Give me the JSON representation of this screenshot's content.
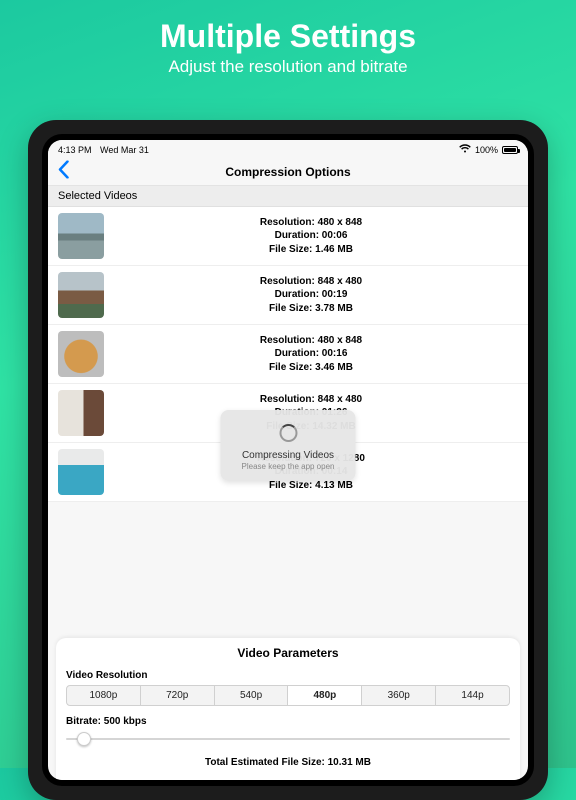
{
  "promo": {
    "headline": "Multiple Settings",
    "subhead": "Adjust the resolution and bitrate"
  },
  "status": {
    "time": "4:13 PM",
    "date": "Wed Mar 31",
    "wifi": "wifi",
    "battery_pct": "100%"
  },
  "nav": {
    "title": "Compression Options"
  },
  "section_header": "Selected Videos",
  "videos": [
    {
      "res": "Resolution: 480 x 848",
      "dur": "Duration: 00:06",
      "size": "File Size: 1.46 MB"
    },
    {
      "res": "Resolution: 848 x 480",
      "dur": "Duration: 00:19",
      "size": "File Size: 3.78 MB"
    },
    {
      "res": "Resolution: 480 x 848",
      "dur": "Duration: 00:16",
      "size": "File Size: 3.46 MB"
    },
    {
      "res": "Resolution: 848 x 480",
      "dur": "Duration: 01:26",
      "size": "File Size: 14.32 MB"
    },
    {
      "res": "Resolution: 720 x 1280",
      "dur": "Duration: 00:14",
      "size": "File Size: 4.13 MB"
    }
  ],
  "overlay": {
    "title": "Compressing Videos",
    "subtitle": "Please keep the app open"
  },
  "params": {
    "panel_title": "Video Parameters",
    "res_label": "Video Resolution",
    "res_options": [
      "1080p",
      "720p",
      "540p",
      "480p",
      "360p",
      "144p"
    ],
    "res_selected_index": 3,
    "bitrate_label": "Bitrate: 500 kbps",
    "estimate": "Total Estimated File Size: 10.31 MB"
  }
}
